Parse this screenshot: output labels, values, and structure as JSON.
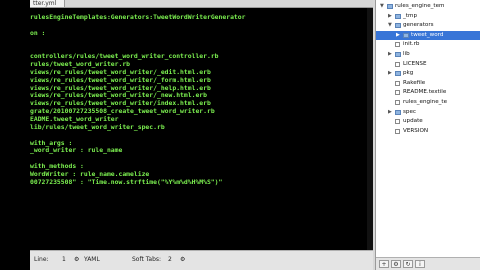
{
  "editor": {
    "tab_title": "tter.yml",
    "lines": [
      "rulesEngineTemplates:Generators:TweetWordWriterGenerator",
      "",
      "on :",
      "",
      "",
      "controllers/rules/tweet_word_writer_controller.rb",
      "rules/tweet_word_writer.rb",
      "views/re_rules/tweet_word_writer/_edit.html.erb",
      "views/re_rules/tweet_word_writer/_form.html.erb",
      "views/re_rules/tweet_word_writer/_help.html.erb",
      "views/re_rules/tweet_word_writer/_new.html.erb",
      "views/re_rules/tweet_word_writer/index.html.erb",
      "grate/20100727235508_create_tweet_word_writer.rb",
      "EADME.tweet_word_writer",
      "lib/rules/tweet_word_writer_spec.rb",
      "",
      "with_args :",
      "_word_writer : rule_name",
      "",
      "with_methods :",
      "WordWriter : rule_name.camelize",
      "00727235508\" : \"Time.now.strftime(\"%Y%m%d%H%M%S\")\""
    ]
  },
  "status": {
    "line_label": "Line:",
    "line_value": "1",
    "mode": "YAML",
    "tabs_label": "Soft Tabs:",
    "tabs_value": "2"
  },
  "drawer": {
    "items": [
      {
        "label": "rules_engine_tem",
        "type": "folder",
        "expanded": true,
        "depth": 0,
        "selected": false
      },
      {
        "label": "_tmp",
        "type": "folder",
        "expanded": false,
        "depth": 1,
        "selected": false
      },
      {
        "label": "generators",
        "type": "folder",
        "expanded": true,
        "depth": 1,
        "selected": false
      },
      {
        "label": "tweet_word",
        "type": "folder",
        "expanded": false,
        "depth": 2,
        "selected": true
      },
      {
        "label": "init.rb",
        "type": "file",
        "expanded": false,
        "depth": 1,
        "selected": false
      },
      {
        "label": "lib",
        "type": "folder",
        "expanded": false,
        "depth": 1,
        "selected": false
      },
      {
        "label": "LICENSE",
        "type": "file",
        "expanded": false,
        "depth": 1,
        "selected": false
      },
      {
        "label": "pkg",
        "type": "folder",
        "expanded": false,
        "depth": 1,
        "selected": false
      },
      {
        "label": "Rakefile",
        "type": "file",
        "expanded": false,
        "depth": 1,
        "selected": false
      },
      {
        "label": "README.textile",
        "type": "file",
        "expanded": false,
        "depth": 1,
        "selected": false
      },
      {
        "label": "rules_engine_te",
        "type": "file",
        "expanded": false,
        "depth": 1,
        "selected": false
      },
      {
        "label": "spec",
        "type": "folder",
        "expanded": false,
        "depth": 1,
        "selected": false
      },
      {
        "label": "update",
        "type": "file",
        "expanded": false,
        "depth": 1,
        "selected": false
      },
      {
        "label": "VERSION",
        "type": "file",
        "expanded": false,
        "depth": 1,
        "selected": false
      }
    ],
    "footer_buttons": [
      "+",
      "⚙",
      "↻",
      "i"
    ]
  }
}
